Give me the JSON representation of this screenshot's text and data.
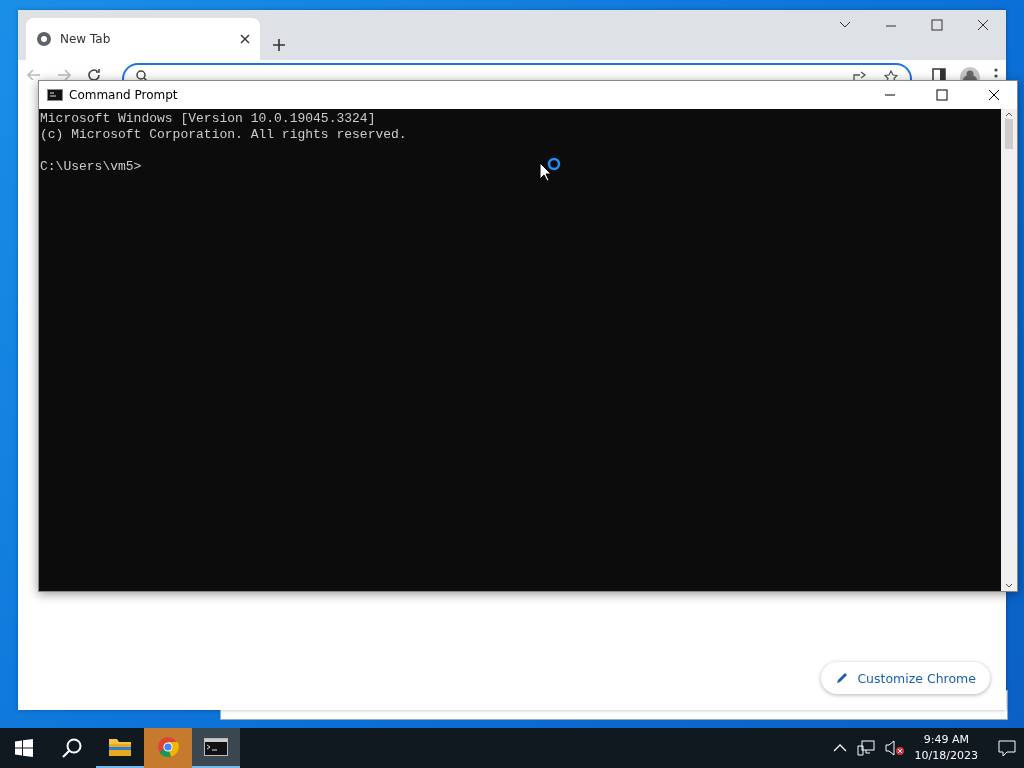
{
  "browser": {
    "tabs": [
      {
        "title": "New Tab",
        "selected": true
      }
    ],
    "customize_button": "Customize Chrome"
  },
  "console": {
    "title": "Command Prompt",
    "output": [
      "Microsoft Windows [Version 10.0.19045.3324]",
      "(c) Microsoft Corporation. All rights reserved."
    ],
    "prompt": "C:\\Users\\vm5>"
  },
  "taskbar": {
    "apps": [
      {
        "kind": "folder",
        "flashing": false,
        "active": false
      },
      {
        "kind": "chrome",
        "flashing": true,
        "active": false
      },
      {
        "kind": "terminal",
        "flashing": false,
        "active": true
      }
    ],
    "time": "9:49 AM",
    "date": "10/18/2023"
  }
}
